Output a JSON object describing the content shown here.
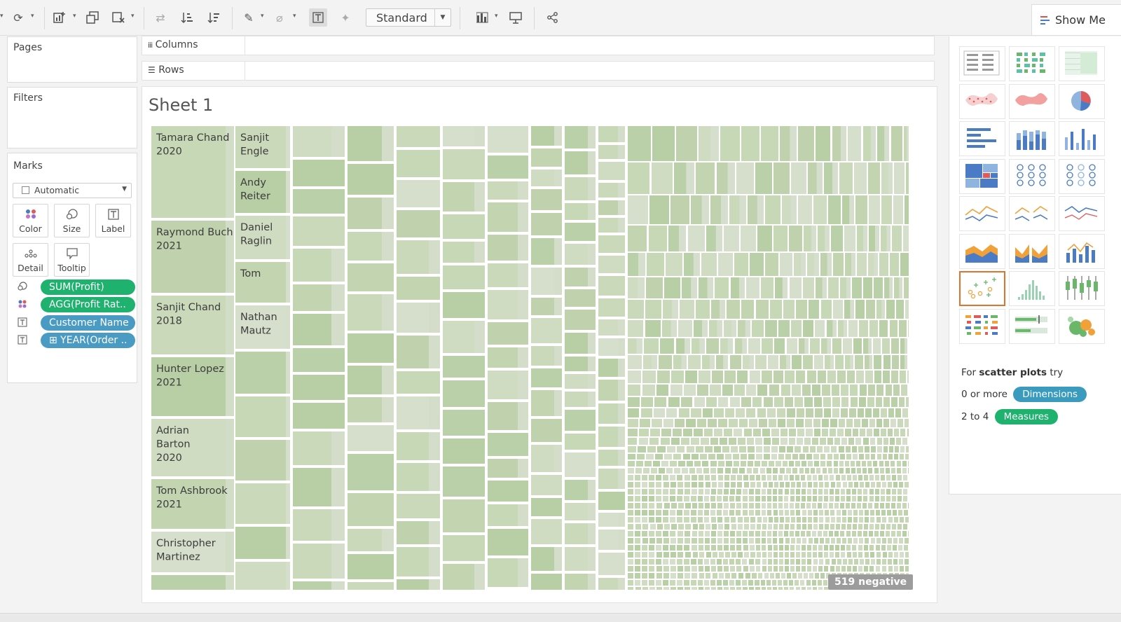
{
  "toolbar": {
    "icons": [
      "refresh-icon",
      "new-worksheet-icon",
      "duplicate-sheet-icon",
      "clear-sheet-icon",
      "swap-axes-icon",
      "sort-ascending-icon",
      "sort-descending-icon",
      "highlight-pen-icon",
      "paperclip-icon",
      "show-labels-icon",
      "pin-icon",
      "chart-bars-icon",
      "presentation-icon",
      "share-icon"
    ],
    "fit_value": "Standard",
    "show_me_label": "Show Me"
  },
  "left": {
    "pages_title": "Pages",
    "filters_title": "Filters",
    "marks_title": "Marks",
    "mark_type": "Automatic",
    "mark_buttons": [
      "Color",
      "Size",
      "Label",
      "Detail",
      "Tooltip"
    ],
    "pills": [
      {
        "label": "SUM(Profit)",
        "color": "#1fb16e",
        "icon": "size-icon"
      },
      {
        "label": "AGG(Profit Rat..",
        "color": "#1fb16e",
        "icon": "color-dots-icon"
      },
      {
        "label": "Customer Name",
        "color": "#4a9bc4",
        "icon": "text-icon"
      },
      {
        "label": "⊞ YEAR(Order ..",
        "color": "#4a9bc4",
        "icon": "text-icon"
      }
    ]
  },
  "shelves": {
    "columns_label": "Columns",
    "rows_label": "Rows"
  },
  "sheet": {
    "title": "Sheet 1",
    "negative_badge": "519 negative",
    "labeled_tiles": [
      "Tamara Chand\n2020",
      "Raymond Buch\n2021",
      "Sanjit Chand\n2018",
      "Hunter Lopez\n2021",
      "Adrian\nBarton\n2020",
      "Tom Ashbrook\n2021",
      "Christopher\nMartinez",
      "Sanjit\nEngle",
      "Andy\nReiter",
      "Daniel\nRaglin",
      "Tom",
      "Nathan\nMautz"
    ]
  },
  "show_me": {
    "hint_prefix": "For",
    "hint_bold": "scatter plots",
    "hint_suffix": "try",
    "dimensions_count": "0 or more",
    "dimensions_label": "Dimensions",
    "measures_count": "2 to 4",
    "measures_label": "Measures",
    "colors": {
      "dimensions": "#3a9bbf",
      "measures": "#1fb16e",
      "selected_border": "#e0742f"
    },
    "chart_types": [
      "text-table",
      "heat-map",
      "highlight-table",
      "symbol-map",
      "filled-map",
      "pie-chart",
      "horizontal-bars",
      "stacked-bars",
      "side-by-side-bars",
      "treemap",
      "circle-views",
      "side-by-side-circles",
      "lines-continuous",
      "lines-discrete",
      "dual-lines",
      "area-continuous",
      "area-discrete",
      "dual-combination",
      "scatter-plot",
      "histogram",
      "box-and-whisker",
      "gantt-chart",
      "bullet-graph",
      "packed-bubbles"
    ]
  }
}
